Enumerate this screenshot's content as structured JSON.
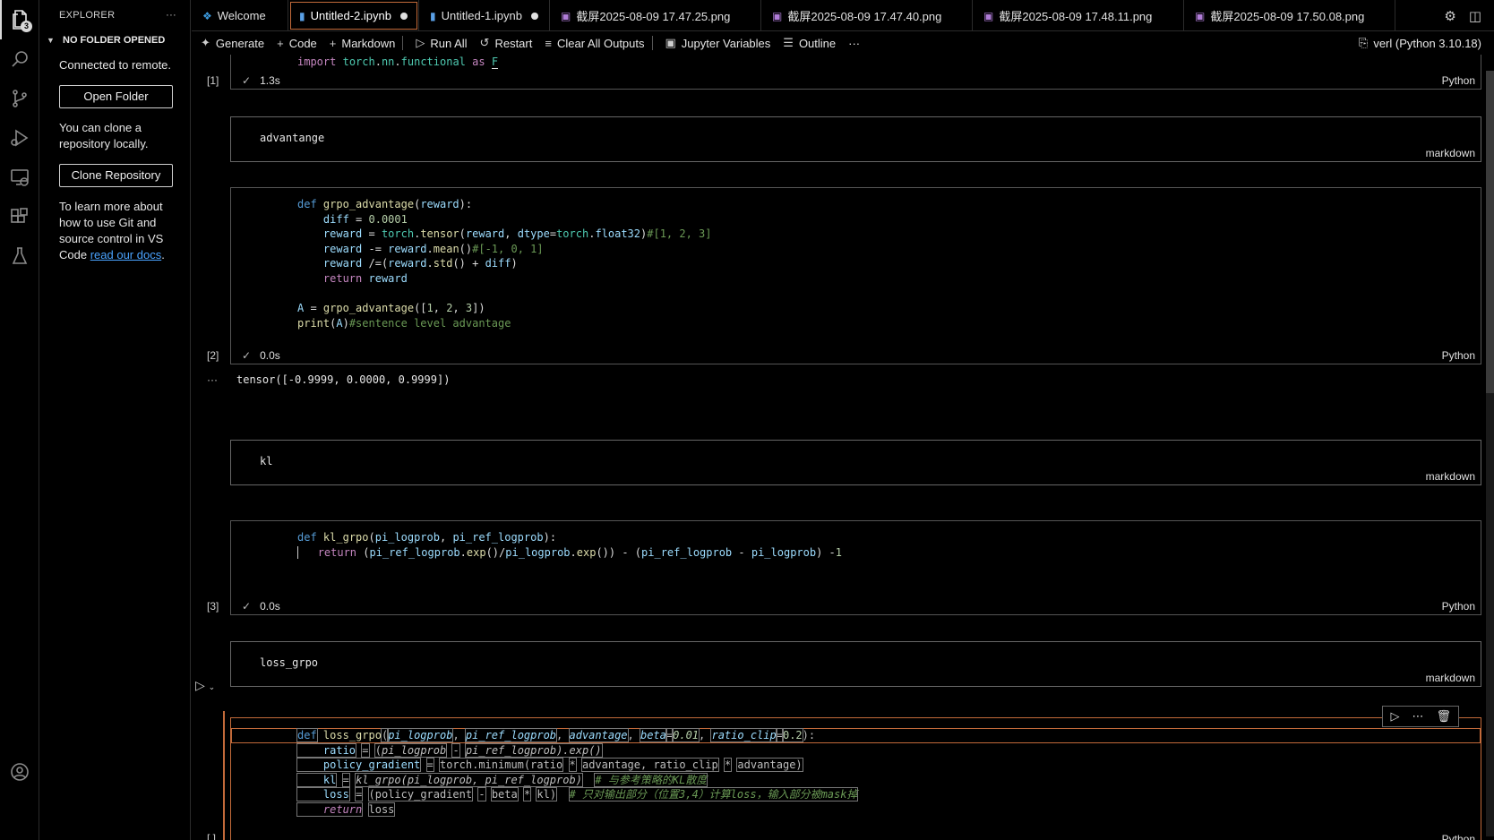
{
  "activity": {
    "explorer_badge": "3",
    "icons": [
      "files-icon",
      "search-icon",
      "source-control-icon",
      "run-debug-icon",
      "remote-explorer-icon",
      "extensions-icon",
      "testing-icon",
      "account-icon"
    ]
  },
  "sidebar": {
    "title": "EXPLORER",
    "more": "···",
    "section": "NO FOLDER OPENED",
    "connected": "Connected to remote.",
    "open_folder": "Open Folder",
    "clone_text": "You can clone a repository locally.",
    "clone_button": "Clone Repository",
    "learn_text": "To learn more about how to use Git and source control in VS Code",
    "learn_link": "read our docs",
    "learn_end": "."
  },
  "tabs": [
    {
      "label": "Welcome",
      "icon": "vscode-icon",
      "dirty": false,
      "active": false
    },
    {
      "label": "Untitled-2.ipynb",
      "icon": "notebook-icon",
      "dirty": true,
      "active": true
    },
    {
      "label": "Untitled-1.ipynb",
      "icon": "notebook-icon",
      "dirty": true,
      "active": false
    },
    {
      "label": "截屏2025-08-09 17.47.25.png",
      "icon": "image-icon",
      "dirty": false,
      "active": false
    },
    {
      "label": "截屏2025-08-09 17.47.40.png",
      "icon": "image-icon",
      "dirty": false,
      "active": false
    },
    {
      "label": "截屏2025-08-09 17.48.11.png",
      "icon": "image-icon",
      "dirty": false,
      "active": false
    },
    {
      "label": "截屏2025-08-09 17.50.08.png",
      "icon": "image-icon",
      "dirty": false,
      "active": false
    }
  ],
  "toolbar": {
    "generate": "Generate",
    "code": "Code",
    "markdown": "Markdown",
    "run_all": "Run All",
    "restart": "Restart",
    "clear_outputs": "Clear All Outputs",
    "variables": "Jupyter Variables",
    "outline": "Outline",
    "more": "···",
    "kernel": "verl (Python 3.10.18)"
  },
  "cells": {
    "c1": {
      "exec": "[1]",
      "time": "1.3s",
      "lang": "Python",
      "code_line": "import torch.nn.functional as F"
    },
    "c2": {
      "text": "advantange",
      "lang": "markdown"
    },
    "c3": {
      "exec": "[2]",
      "time": "0.0s",
      "lang": "Python",
      "output": "tensor([-0.9999,  0.0000,  0.9999])",
      "ellipsis": "···"
    },
    "c4": {
      "text": "kl",
      "lang": "markdown"
    },
    "c5": {
      "exec": "[3]",
      "time": "0.0s",
      "lang": "Python"
    },
    "c6": {
      "text": "loss_grpo",
      "lang": "markdown"
    },
    "c7": {
      "exec": "[ ]",
      "lang": "Python"
    }
  }
}
